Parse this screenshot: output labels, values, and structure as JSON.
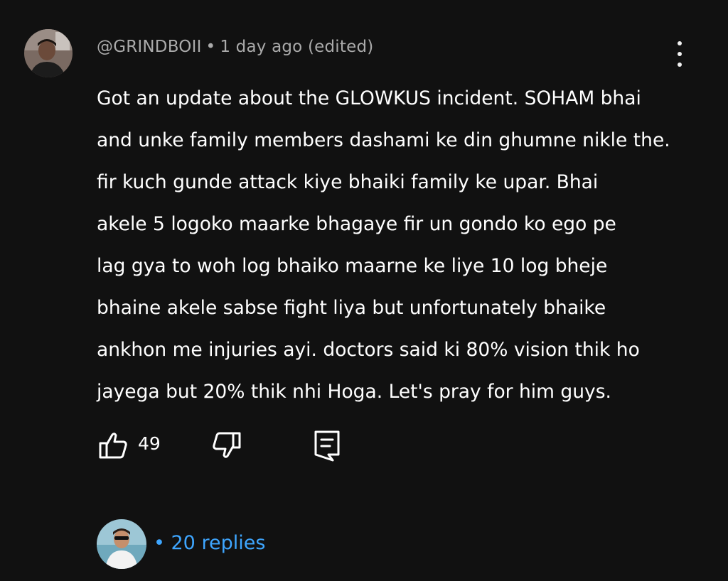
{
  "comment": {
    "author": "@GRINDBOII",
    "separator": "•",
    "time": "1 day ago (edited)",
    "text": "Got an update about the GLOWKUS incident. SOHAM bhai\nand unke family members dashami ke din ghumne nikle the.\nfir kuch gunde attack kiye bhaiki family ke upar. Bhai\nakele 5 logoko maarke bhagaye fir un gondo ko ego pe\nlag gya to woh log bhaiko maarne ke liye 10 log bheje\nbhaine akele sabse fight liya but unfortunately bhaike\nankhon me injuries ayi. doctors said ki 80% vision thik ho\njayega but 20% thik nhi Hoga. Let's pray for him guys.",
    "like_count": "49"
  },
  "icons": {
    "like": "thumbs-up-icon",
    "dislike": "thumbs-down-icon",
    "reply": "comment-icon",
    "menu": "more-vertical-icon"
  },
  "replies": {
    "label": "• 20 replies"
  },
  "colors": {
    "background": "#111111",
    "meta_text": "#aaaaaa",
    "body_text": "#ffffff",
    "replies_link": "#3ea6ff"
  }
}
